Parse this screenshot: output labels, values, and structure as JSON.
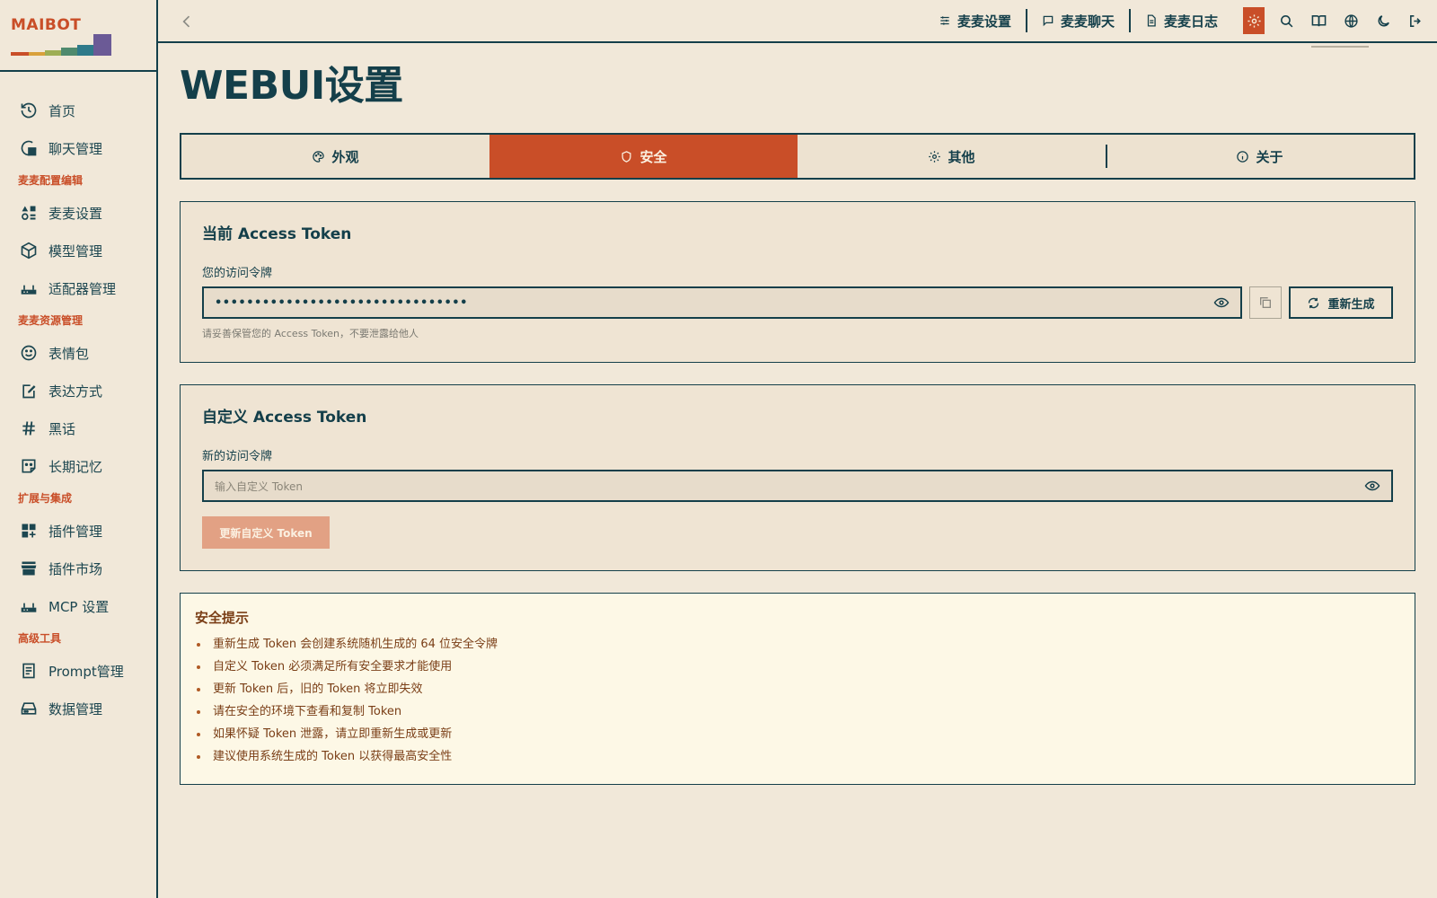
{
  "app": {
    "logo_text": "MAIBOT"
  },
  "sidebar": {
    "items": [
      {
        "label": "首页",
        "icon": "home-history-icon"
      },
      {
        "label": "聊天管理",
        "icon": "chat-icon"
      },
      {
        "section": "麦麦配置编辑"
      },
      {
        "label": "麦麦设置",
        "icon": "shapes-icon"
      },
      {
        "label": "模型管理",
        "icon": "box-icon"
      },
      {
        "label": "适配器管理",
        "icon": "router-icon"
      },
      {
        "section": "麦麦资源管理"
      },
      {
        "label": "表情包",
        "icon": "smile-icon"
      },
      {
        "label": "表达方式",
        "icon": "edit-note-icon"
      },
      {
        "label": "黑话",
        "icon": "hash-icon"
      },
      {
        "label": "长期记忆",
        "icon": "sticky-note-icon"
      },
      {
        "section": "扩展与集成"
      },
      {
        "label": "插件管理",
        "icon": "grid-plus-icon"
      },
      {
        "label": "插件市场",
        "icon": "store-icon"
      },
      {
        "label": "MCP 设置",
        "icon": "router-icon"
      },
      {
        "section": "高级工具"
      },
      {
        "label": "Prompt管理",
        "icon": "clipboard-icon"
      },
      {
        "label": "数据管理",
        "icon": "drive-icon"
      }
    ]
  },
  "topbar": {
    "links": [
      {
        "label": "麦麦设置",
        "icon": "sliders-icon"
      },
      {
        "label": "麦麦聊天",
        "icon": "message-icon"
      },
      {
        "label": "麦麦日志",
        "icon": "file-icon"
      }
    ],
    "icons": [
      "settings-icon",
      "search-icon",
      "book-icon",
      "globe-icon",
      "moon-icon",
      "logout-icon"
    ],
    "accent": "#c94e28"
  },
  "page": {
    "title": "WEBUI设置",
    "tabs": [
      {
        "label": "外观",
        "icon": "palette-icon"
      },
      {
        "label": "安全",
        "icon": "shield-icon",
        "active": true
      },
      {
        "label": "其他",
        "icon": "settings-icon"
      },
      {
        "label": "关于",
        "icon": "info-icon"
      }
    ]
  },
  "current_token": {
    "title": "当前 Access Token",
    "label": "您的访问令牌",
    "value": "••••••••••••••••••••••••••••••••",
    "regenerate_label": "重新生成",
    "hint": "请妥善保管您的 Access Token，不要泄露给他人"
  },
  "custom_token": {
    "title": "自定义 Access Token",
    "label": "新的访问令牌",
    "placeholder": "输入自定义 Token",
    "value": "",
    "update_label": "更新自定义 Token"
  },
  "tips": {
    "title": "安全提示",
    "items": [
      "重新生成 Token 会创建系统随机生成的 64 位安全令牌",
      "自定义 Token 必须满足所有安全要求才能使用",
      "更新 Token 后，旧的 Token 将立即失效",
      "请在安全的环境下查看和复制 Token",
      "如果怀疑 Token 泄露，请立即重新生成或更新",
      "建议使用系统生成的 Token 以获得最高安全性"
    ]
  },
  "colors": {
    "background": "#f1e8d9",
    "ink": "#143f4a",
    "accent": "#c94e28",
    "tips_text": "#7a3e16"
  }
}
